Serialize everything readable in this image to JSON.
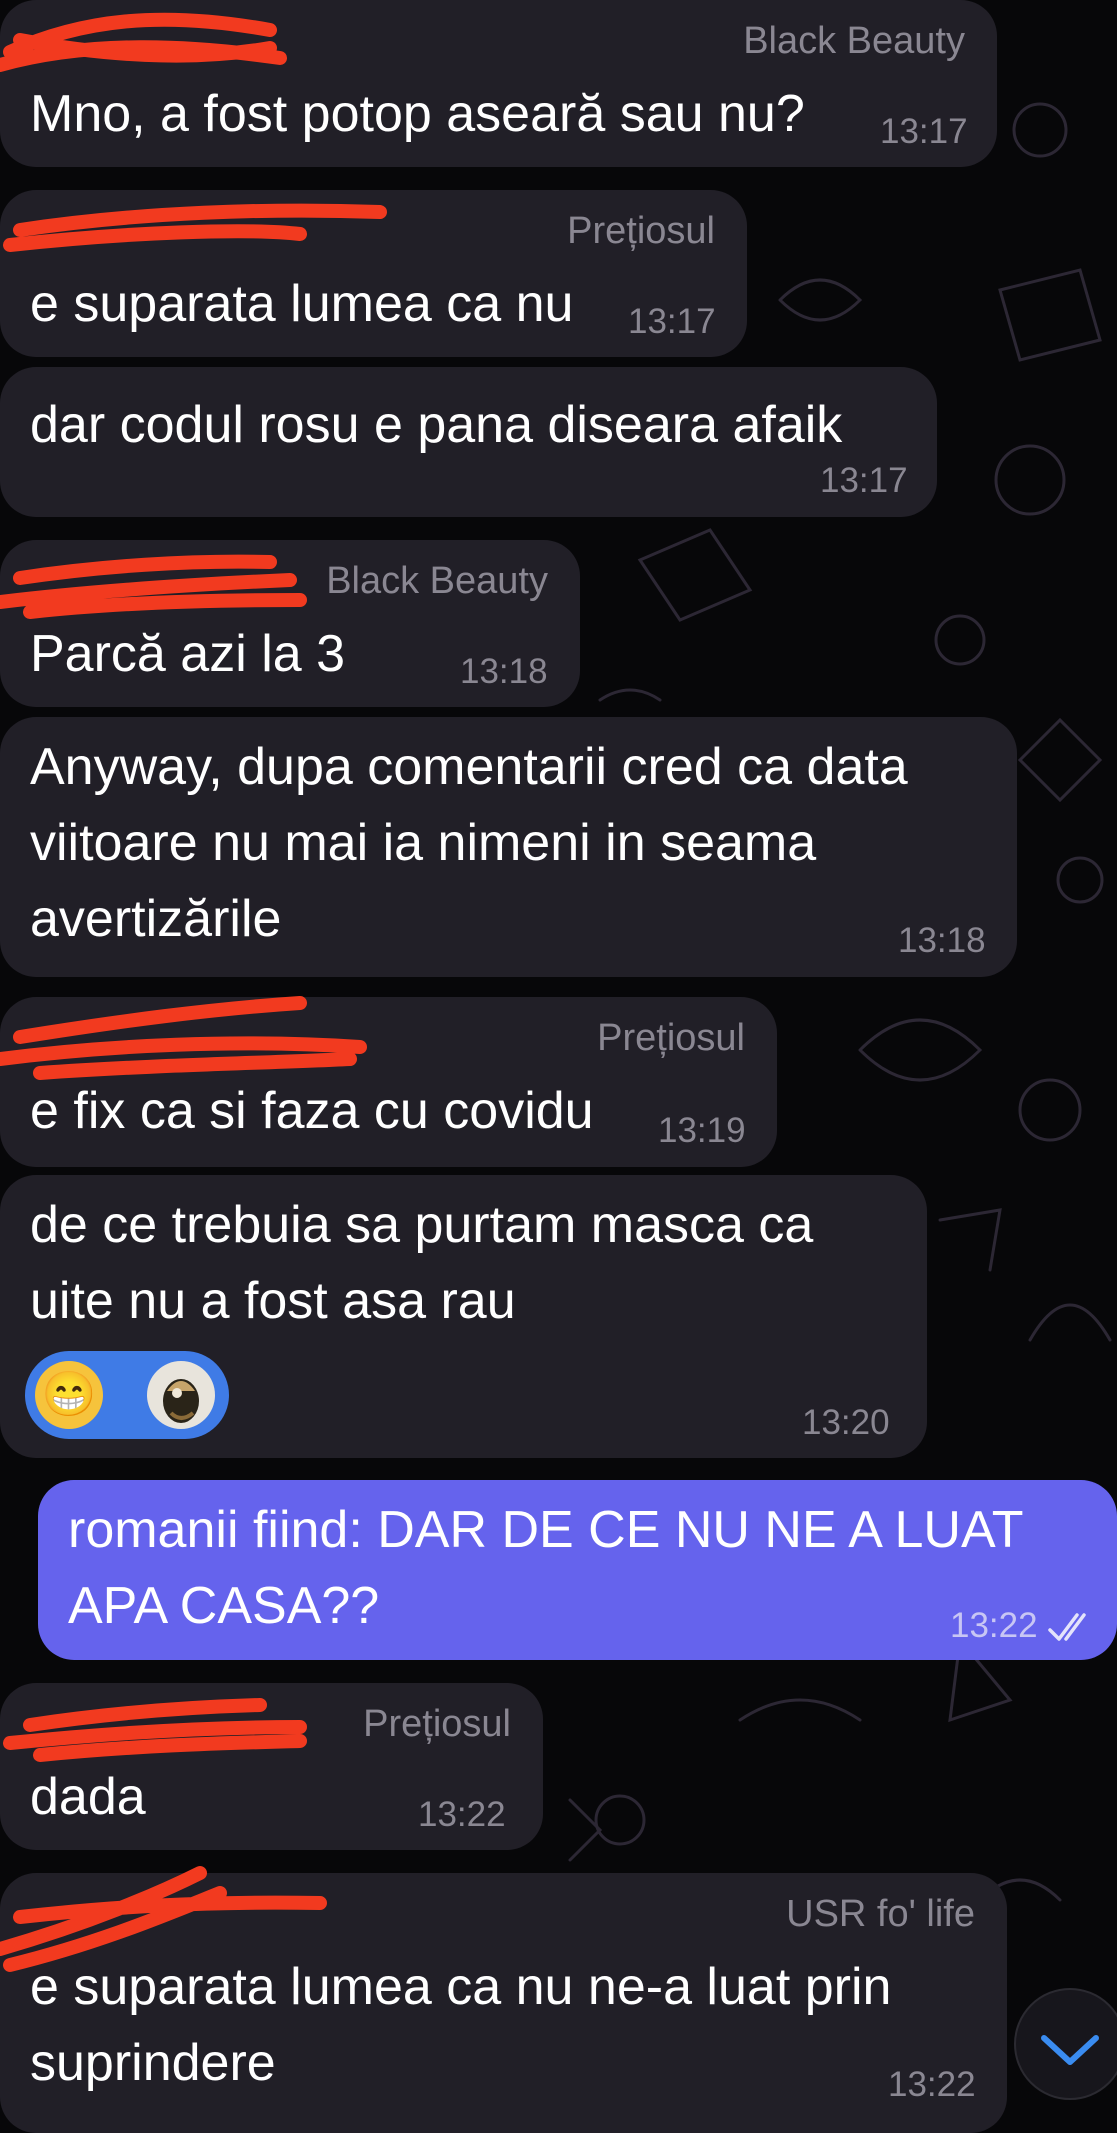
{
  "chat": {
    "messages": [
      {
        "sender": "Black Beauty",
        "text": [
          "Mno, a fost potop aseară sau nu?"
        ],
        "time": "13:17"
      },
      {
        "sender": "Prețiosul",
        "text": [
          "e suparata lumea ca nu"
        ],
        "time": "13:17"
      },
      {
        "sender": "",
        "text": [
          "dar codul rosu e pana diseara afaik"
        ],
        "time": "13:17"
      },
      {
        "sender": "Black Beauty",
        "text": [
          "Parcă azi la 3"
        ],
        "time": "13:18"
      },
      {
        "sender": "",
        "text": [
          "Anyway, dupa comentarii cred ca data",
          "viitoare nu mai ia nimeni in seama",
          "avertizările"
        ],
        "time": "13:18"
      },
      {
        "sender": "Prețiosul",
        "text": [
          "e fix ca si faza cu covidu"
        ],
        "time": "13:19"
      },
      {
        "sender": "",
        "text": [
          "de ce trebuia sa purtam masca ca",
          "uite nu a fost asa rau"
        ],
        "time": "13:20",
        "reactions": [
          "grinning-face-emoji",
          "reactor-avatar"
        ]
      },
      {
        "sender": "",
        "outgoing": true,
        "text": [
          "romanii fiind: DAR DE CE NU NE A LUAT",
          "APA CASA??"
        ],
        "time": "13:22",
        "status": "read-double-check"
      },
      {
        "sender": "Prețiosul",
        "text": [
          "dada"
        ],
        "time": "13:22"
      },
      {
        "sender": "USR fo' life",
        "text": [
          "e suparata lumea ca nu ne-a luat prin",
          "suprindere"
        ],
        "time": "13:22"
      }
    ]
  },
  "reaction_emoji": "😁",
  "icons": {
    "scroll_down": "chevron-down-icon",
    "read_status": "double-check-icon"
  },
  "colors": {
    "background": "#070709",
    "incoming_bubble": "#211f27",
    "outgoing_bubble": "#6563ed",
    "meta_text": "#8a8792",
    "redaction": "#f23a1f",
    "reaction_pill": "#3f7be6",
    "scroll_chevron": "#3a8cf0"
  }
}
